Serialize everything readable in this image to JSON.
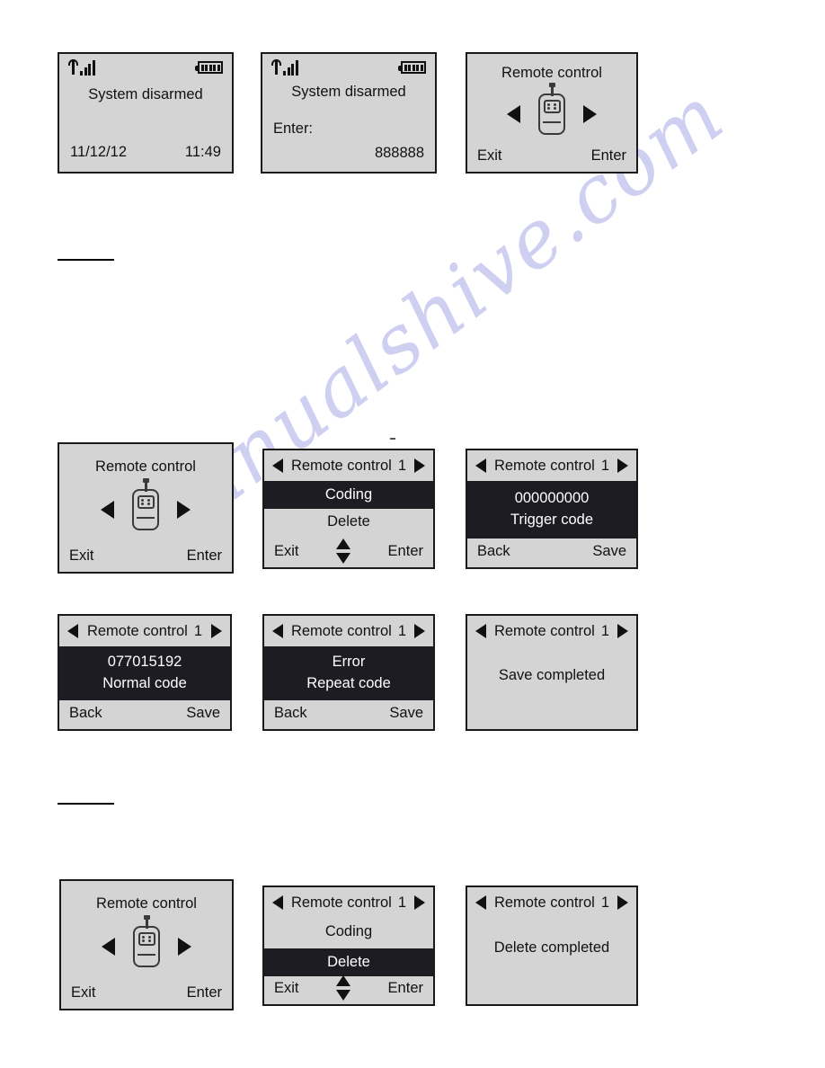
{
  "document": {
    "watermark": "manualshive.com",
    "watermark_color": "#cdcdf2",
    "background": "#ffffff",
    "lcd_background": "#d4d4d4",
    "lcd_border": "#1a1a1a",
    "highlight_background": "#1c1c22",
    "highlight_text": "#ffffff"
  },
  "panels": {
    "p1": {
      "status": {
        "signal_icon": "signal-bars-icon",
        "signal_bars": 4,
        "battery_icon": "battery-full-icon",
        "battery_segments": 5
      },
      "message": "System  disarmed",
      "date": "11/12/12",
      "time": "11:49"
    },
    "p2": {
      "status": {
        "signal_icon": "signal-bars-icon",
        "signal_bars": 4,
        "battery_icon": "battery-full-icon",
        "battery_segments": 5
      },
      "message": "System  disarmed",
      "prompt": "Enter:",
      "value": "888888"
    },
    "p3": {
      "title": "Remote control",
      "icon": "remote-control-icon",
      "left_arrow": "arrow-left-icon",
      "right_arrow": "arrow-right-icon",
      "softkey_left": "Exit",
      "softkey_right": "Enter"
    },
    "p4": {
      "title": "Remote control",
      "icon": "remote-control-icon",
      "left_arrow": "arrow-left-icon",
      "right_arrow": "arrow-right-icon",
      "softkey_left": "Exit",
      "softkey_right": "Enter"
    },
    "p5": {
      "header_title": "Remote control",
      "header_num": "1",
      "row_selected": "Coding",
      "row_other": "Delete",
      "softkey_left": "Exit",
      "softkey_right": "Enter",
      "scroll_icon": "up-down-arrows-icon"
    },
    "p6": {
      "header_title": "Remote control",
      "header_num": "1",
      "code": "000000000",
      "code_label": "Trigger  code",
      "softkey_left": "Back",
      "softkey_right": "Save"
    },
    "p7": {
      "header_title": "Remote control",
      "header_num": "1",
      "code": "077015192",
      "code_label": "Normal  code",
      "softkey_left": "Back",
      "softkey_right": "Save"
    },
    "p8": {
      "header_title": "Remote control",
      "header_num": "1",
      "code": "Error",
      "code_label": "Repeat  code",
      "softkey_left": "Back",
      "softkey_right": "Save"
    },
    "p9": {
      "header_title": "Remote control",
      "header_num": "1",
      "message": "Save  completed"
    },
    "p10": {
      "title": "Remote control",
      "icon": "remote-control-icon",
      "left_arrow": "arrow-left-icon",
      "right_arrow": "arrow-right-icon",
      "softkey_left": "Exit",
      "softkey_right": "Enter"
    },
    "p11": {
      "header_title": "Remote control",
      "header_num": "1",
      "row_other": "Coding",
      "row_selected": "Delete",
      "softkey_left": "Exit",
      "softkey_right": "Enter",
      "scroll_icon": "up-down-arrows-icon"
    },
    "p12": {
      "header_title": "Remote control",
      "header_num": "1",
      "message": "Delete  completed"
    }
  }
}
